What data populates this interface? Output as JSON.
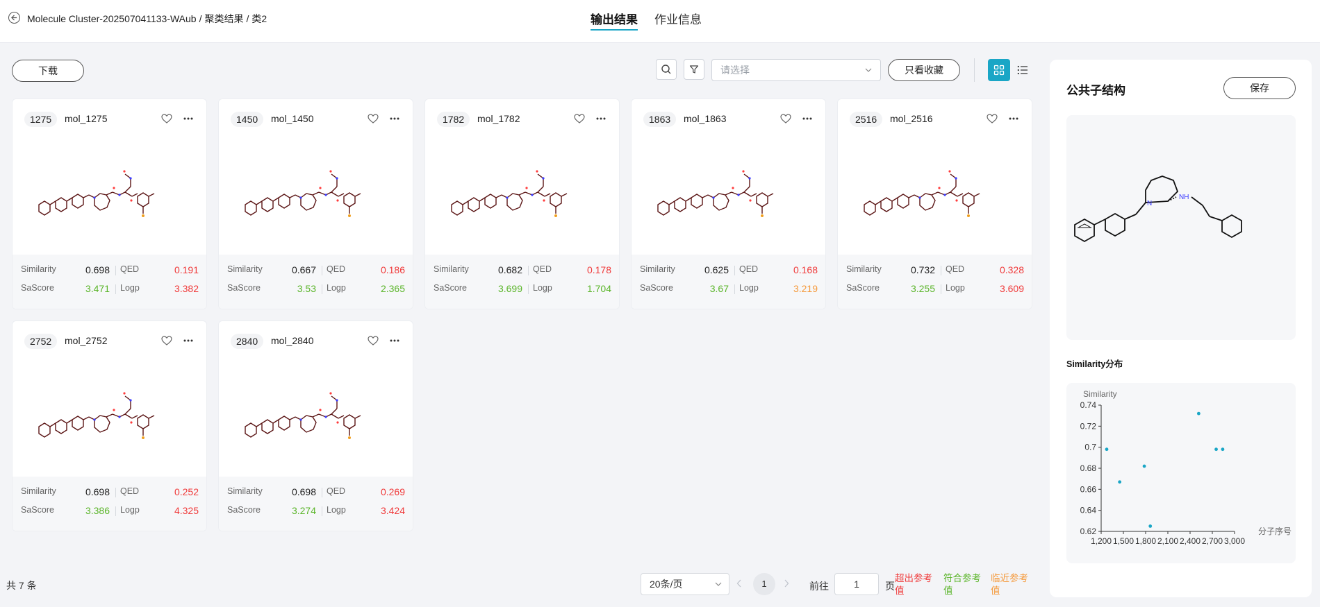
{
  "header": {
    "breadcrumb": [
      "Molecule Cluster-202507041133-WAub",
      "/",
      "聚类结果",
      "/",
      "类2"
    ],
    "tabs": [
      {
        "label": "输出结果",
        "active": true
      },
      {
        "label": "作业信息",
        "active": false
      }
    ]
  },
  "toolbar": {
    "download_label": "下载",
    "select_placeholder": "请选择",
    "favorites_label": "只看收藏",
    "view_mode": "grid",
    "accent_color": "#1aa6c6"
  },
  "cards": [
    {
      "id": "1275",
      "name": "mol_1275",
      "similarity": "0.698",
      "qed": "0.191",
      "qed_status": "red",
      "sascore": "3.471",
      "sascore_status": "green",
      "logp": "3.382",
      "logp_status": "red"
    },
    {
      "id": "1450",
      "name": "mol_1450",
      "similarity": "0.667",
      "qed": "0.186",
      "qed_status": "red",
      "sascore": "3.53",
      "sascore_status": "green",
      "logp": "2.365",
      "logp_status": "green"
    },
    {
      "id": "1782",
      "name": "mol_1782",
      "similarity": "0.682",
      "qed": "0.178",
      "qed_status": "red",
      "sascore": "3.699",
      "sascore_status": "green",
      "logp": "1.704",
      "logp_status": "green"
    },
    {
      "id": "1863",
      "name": "mol_1863",
      "similarity": "0.625",
      "qed": "0.168",
      "qed_status": "red",
      "sascore": "3.67",
      "sascore_status": "green",
      "logp": "3.219",
      "logp_status": "orange"
    },
    {
      "id": "2516",
      "name": "mol_2516",
      "similarity": "0.732",
      "qed": "0.328",
      "qed_status": "red",
      "sascore": "3.255",
      "sascore_status": "green",
      "logp": "3.609",
      "logp_status": "red"
    },
    {
      "id": "2752",
      "name": "mol_2752",
      "similarity": "0.698",
      "qed": "0.252",
      "qed_status": "red",
      "sascore": "3.386",
      "sascore_status": "green",
      "logp": "4.325",
      "logp_status": "red"
    },
    {
      "id": "2840",
      "name": "mol_2840",
      "similarity": "0.698",
      "qed": "0.269",
      "qed_status": "red",
      "sascore": "3.274",
      "sascore_status": "green",
      "logp": "3.424",
      "logp_status": "red"
    }
  ],
  "stat_labels": {
    "similarity": "Similarity",
    "qed": "QED",
    "sascore": "SaScore",
    "logp": "Logp"
  },
  "status_colors": {
    "red": "#f03a3a",
    "green": "#5bb52a",
    "orange": "#f59a3c"
  },
  "footer": {
    "total": "共 7 条",
    "page_size": "20条/页",
    "current_page": "1",
    "goto_label": "前往",
    "goto_value": "1",
    "page_unit": "页",
    "legend": [
      {
        "label": "超出参考值",
        "color": "red"
      },
      {
        "label": "符合参考值",
        "color": "green"
      },
      {
        "label": "临近参考值",
        "color": "orange"
      }
    ]
  },
  "panel": {
    "title": "公共子结构",
    "save_label": "保存",
    "struct_nh_label": "NH",
    "struct_n_label": "N",
    "distribution_title": "Similarity分布"
  },
  "chart_data": {
    "type": "scatter",
    "title": "",
    "ylabel": "Similarity",
    "xlabel": "分子序号",
    "xlim": [
      1200,
      3000
    ],
    "ylim": [
      0.62,
      0.74
    ],
    "x_ticks": [
      "1,200",
      "1,500",
      "1,800",
      "2,100",
      "2,400",
      "2,700",
      "3,000"
    ],
    "y_ticks": [
      "0.62",
      "0.64",
      "0.66",
      "0.68",
      "0.7",
      "0.72",
      "0.74"
    ],
    "point_color": "#1aa6c6",
    "points": [
      {
        "x": 1275,
        "y": 0.698
      },
      {
        "x": 1450,
        "y": 0.667
      },
      {
        "x": 1782,
        "y": 0.682
      },
      {
        "x": 1863,
        "y": 0.625
      },
      {
        "x": 2516,
        "y": 0.732
      },
      {
        "x": 2752,
        "y": 0.698
      },
      {
        "x": 2840,
        "y": 0.698
      }
    ]
  }
}
